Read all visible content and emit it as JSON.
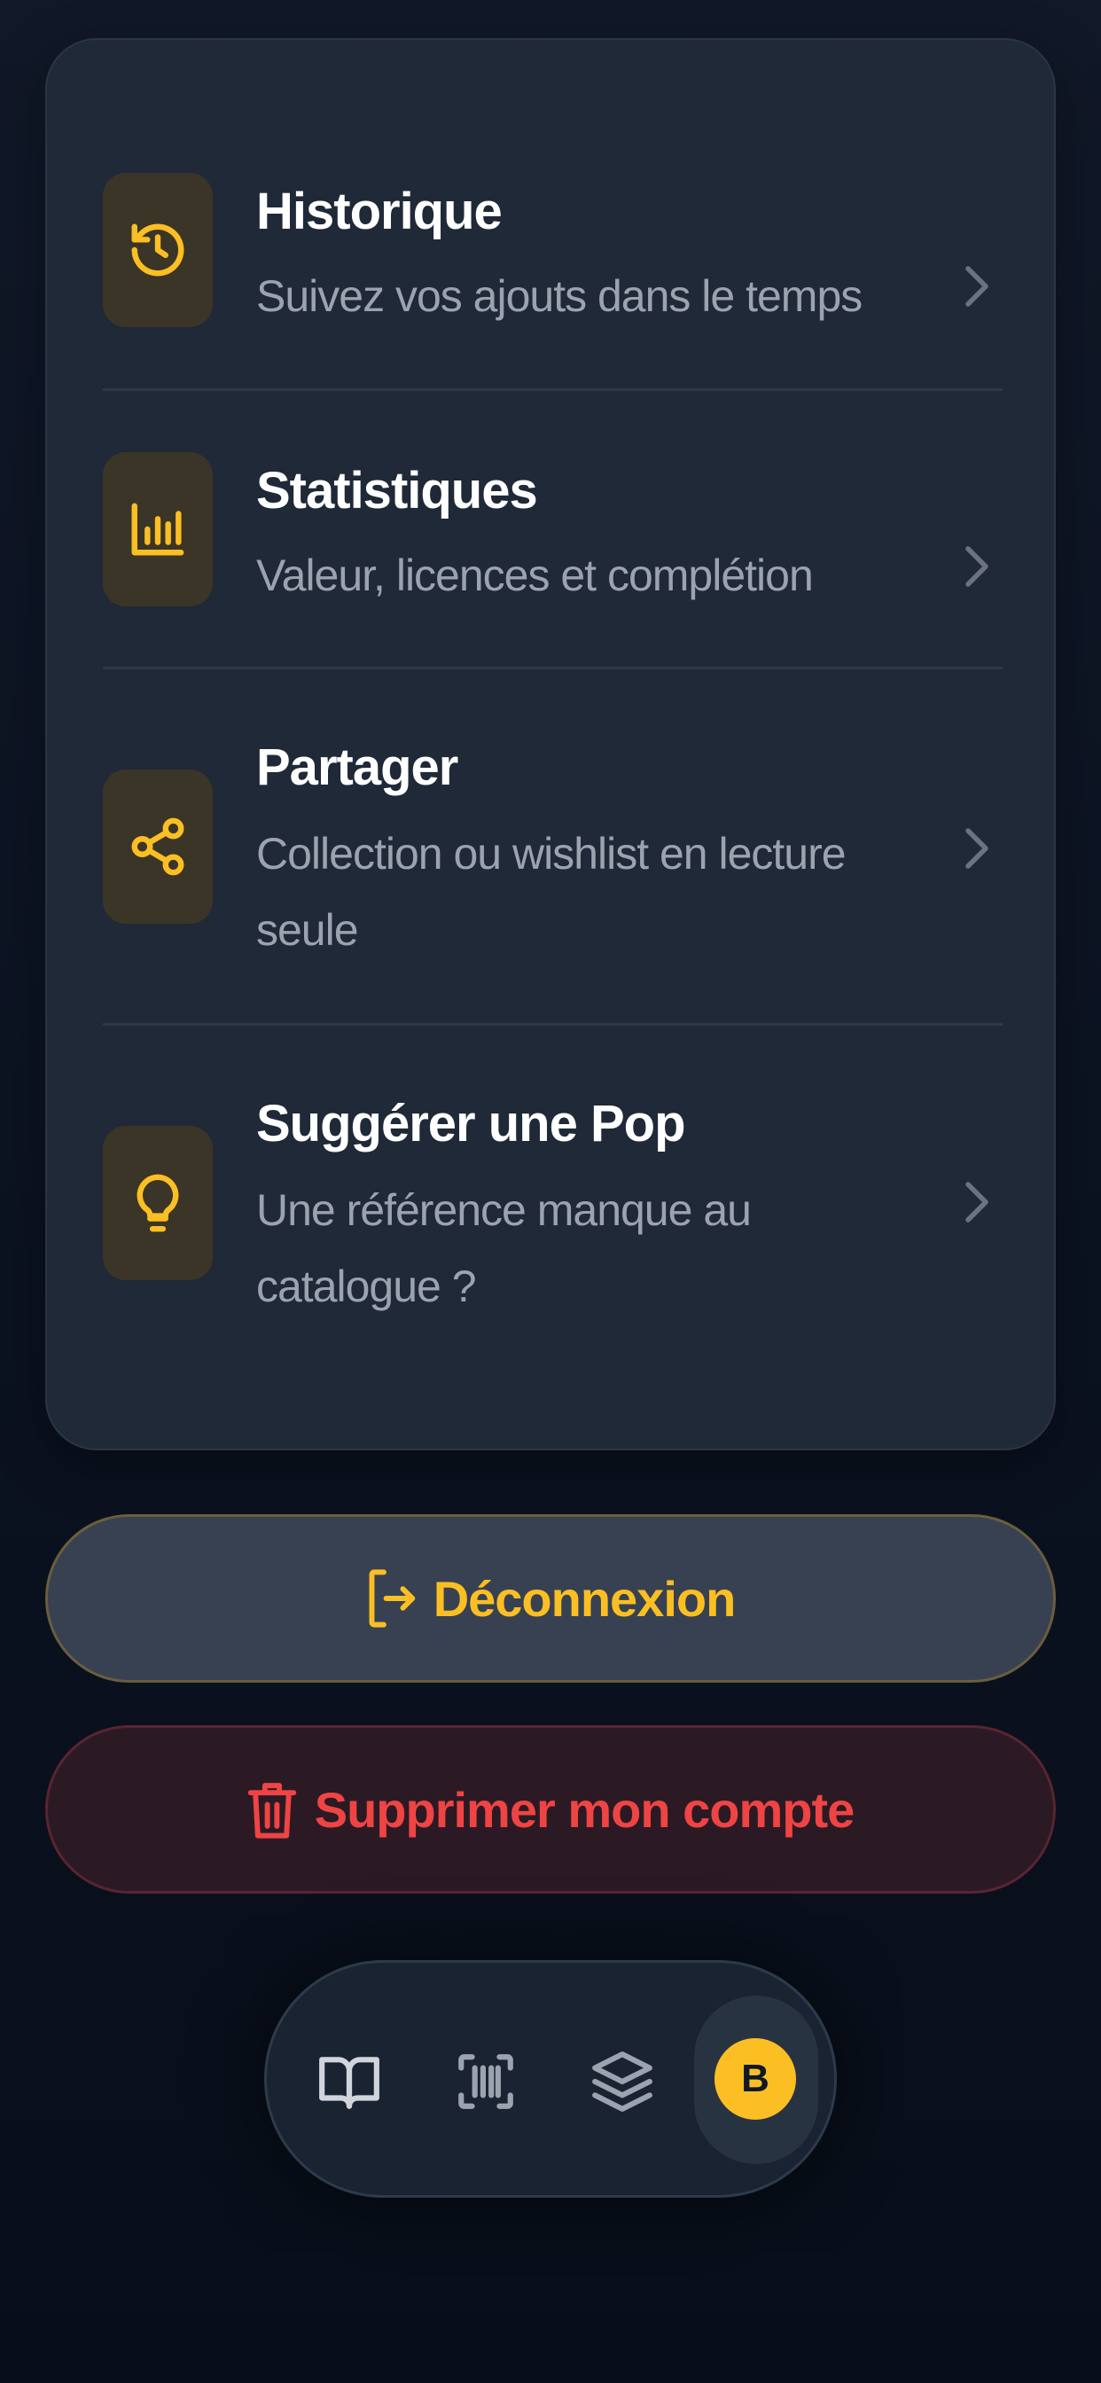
{
  "menu": {
    "items": [
      {
        "title": "Historique",
        "subtitle": "Suivez vos ajouts dans le temps",
        "icon": "history-icon"
      },
      {
        "title": "Statistiques",
        "subtitle": "Valeur, licences et complétion",
        "icon": "bar-chart-icon"
      },
      {
        "title": "Partager",
        "subtitle": "Collection ou wishlist en lecture seule",
        "icon": "share-icon"
      },
      {
        "title": "Suggérer une Pop",
        "subtitle": "Une référence manque au catalogue ?",
        "icon": "lightbulb-icon"
      }
    ]
  },
  "actions": {
    "logout_label": "Déconnexion",
    "delete_label": "Supprimer mon compte"
  },
  "tabbar": {
    "tabs": [
      {
        "icon": "book-icon"
      },
      {
        "icon": "barcode-scan-icon"
      },
      {
        "icon": "layers-icon"
      }
    ],
    "avatar_initial": "B"
  },
  "colors": {
    "accent": "#fbbf24",
    "danger": "#ef4444",
    "card": "#1f2937",
    "background": "#0b1220"
  }
}
